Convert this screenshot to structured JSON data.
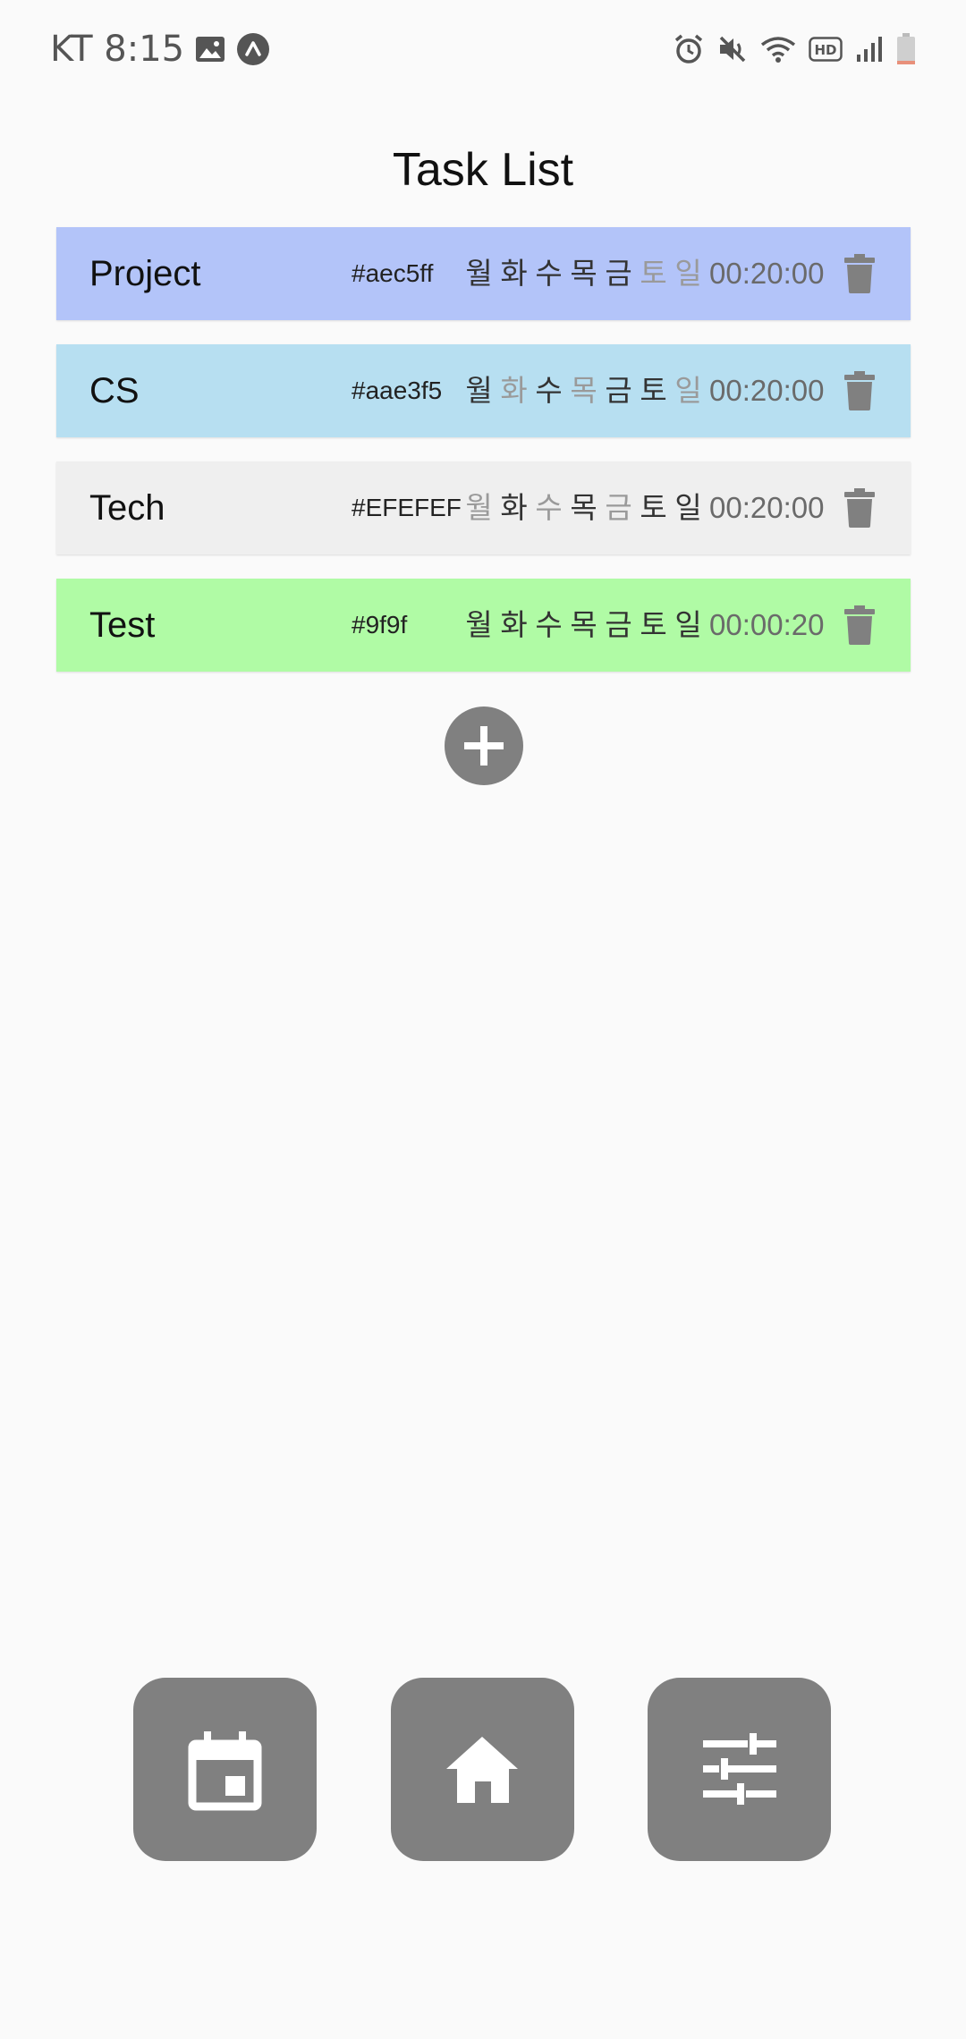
{
  "status_bar": {
    "carrier_time": "KT 8:15",
    "icons_left": [
      "image-icon",
      "app-notification-icon"
    ],
    "icons_right": [
      "alarm-icon",
      "mute-icon",
      "wifi-icon",
      "hd-icon",
      "signal-icon",
      "battery-icon"
    ],
    "hd_label": "HD"
  },
  "title": "Task List",
  "tasks": [
    {
      "name": "Project",
      "color_label": "#aec5ff",
      "bg": "#b3c4f9",
      "days": [
        {
          "label": "월",
          "active": true
        },
        {
          "label": "화",
          "active": true
        },
        {
          "label": "수",
          "active": true
        },
        {
          "label": "목",
          "active": true
        },
        {
          "label": "금",
          "active": true
        },
        {
          "label": "토",
          "active": false
        },
        {
          "label": "일",
          "active": false
        }
      ],
      "time": "00:20:00"
    },
    {
      "name": "CS",
      "color_label": "#aae3f5",
      "bg": "#b7dff1",
      "days": [
        {
          "label": "월",
          "active": true
        },
        {
          "label": "화",
          "active": false
        },
        {
          "label": "수",
          "active": true
        },
        {
          "label": "목",
          "active": false
        },
        {
          "label": "금",
          "active": true
        },
        {
          "label": "토",
          "active": true
        },
        {
          "label": "일",
          "active": false
        }
      ],
      "time": "00:20:00"
    },
    {
      "name": "Tech",
      "color_label": "#EFEFEF",
      "bg": "#efefef",
      "days": [
        {
          "label": "월",
          "active": false
        },
        {
          "label": "화",
          "active": true
        },
        {
          "label": "수",
          "active": false
        },
        {
          "label": "목",
          "active": true
        },
        {
          "label": "금",
          "active": false
        },
        {
          "label": "토",
          "active": true
        },
        {
          "label": "일",
          "active": true
        }
      ],
      "time": "00:20:00"
    },
    {
      "name": "Test",
      "color_label": "#9f9f",
      "bg": "#b0fba5",
      "days": [
        {
          "label": "월",
          "active": true
        },
        {
          "label": "화",
          "active": true
        },
        {
          "label": "수",
          "active": true
        },
        {
          "label": "목",
          "active": true
        },
        {
          "label": "금",
          "active": true
        },
        {
          "label": "토",
          "active": true
        },
        {
          "label": "일",
          "active": true
        }
      ],
      "time": "00:00:20"
    }
  ],
  "add_button_icon": "plus-icon",
  "bottom_nav": [
    {
      "icon": "calendar-icon"
    },
    {
      "icon": "home-icon"
    },
    {
      "icon": "sliders-icon"
    }
  ],
  "colors": {
    "accent_gray": "#808080",
    "text_dark": "#111111",
    "day_on": "#333333",
    "day_off": "#9a9a9a",
    "time_text": "#6a6a6a"
  }
}
